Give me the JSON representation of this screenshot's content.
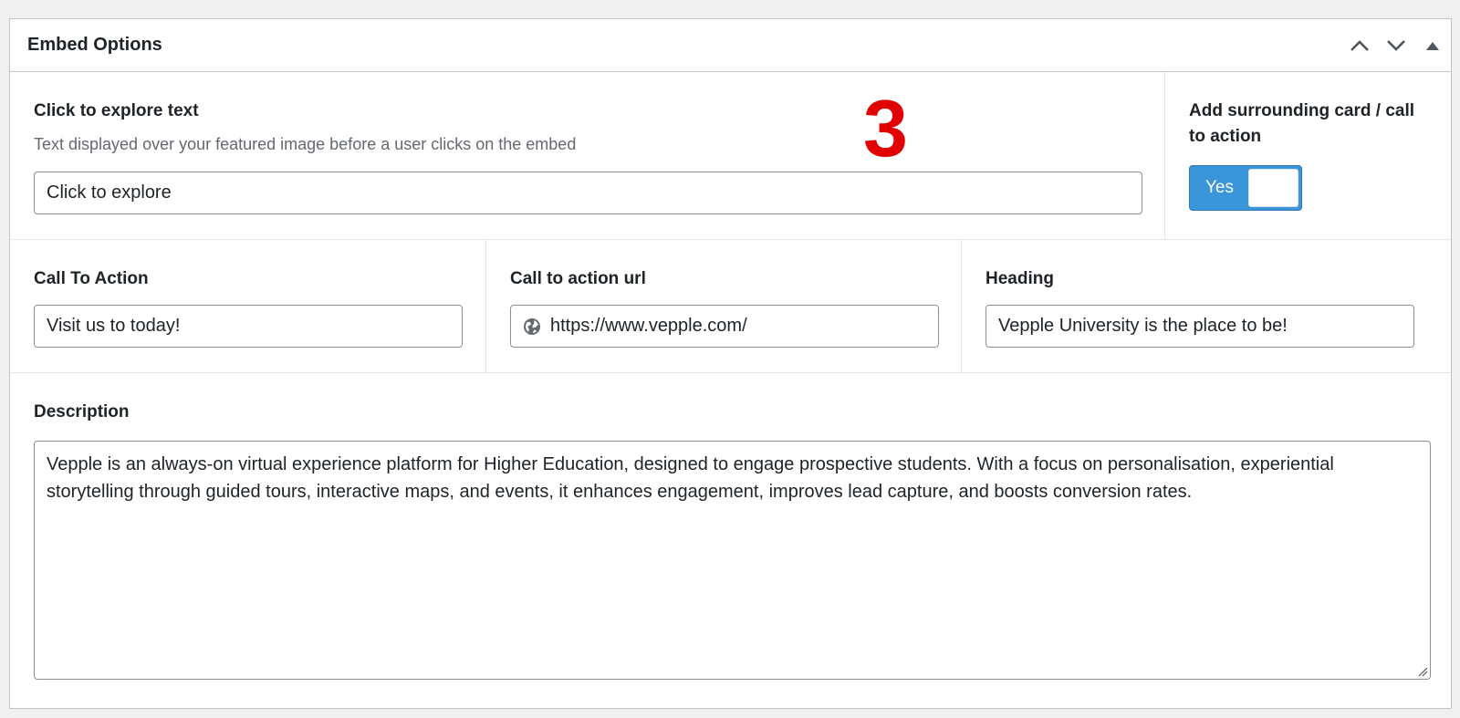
{
  "panel": {
    "title": "Embed Options",
    "controls": [
      "chevron-up-icon",
      "chevron-down-icon",
      "caret-up-icon"
    ]
  },
  "annotation": {
    "number": "3",
    "color": "#e00000"
  },
  "explore": {
    "label": "Click to explore text",
    "hint": "Text displayed over your featured image before a user clicks on the embed",
    "value": "Click to explore"
  },
  "card": {
    "label": "Add surrounding card / call to action",
    "toggle_text": "Yes",
    "toggle_on": true,
    "toggle_color": "#3b95d9"
  },
  "cta": {
    "label": "Call To Action",
    "value": "Visit us to today!"
  },
  "cta_url": {
    "label": "Call to action url",
    "icon": "globe-icon",
    "value": "https://www.vepple.com/"
  },
  "heading": {
    "label": "Heading",
    "value": "Vepple University is the place to be!"
  },
  "description": {
    "label": "Description",
    "value": "Vepple is an always-on virtual experience platform for Higher Education, designed to engage prospective students. With a focus on personalisation, experiential storytelling through guided tours, interactive maps, and events, it enhances engagement, improves lead capture, and boosts conversion rates."
  }
}
